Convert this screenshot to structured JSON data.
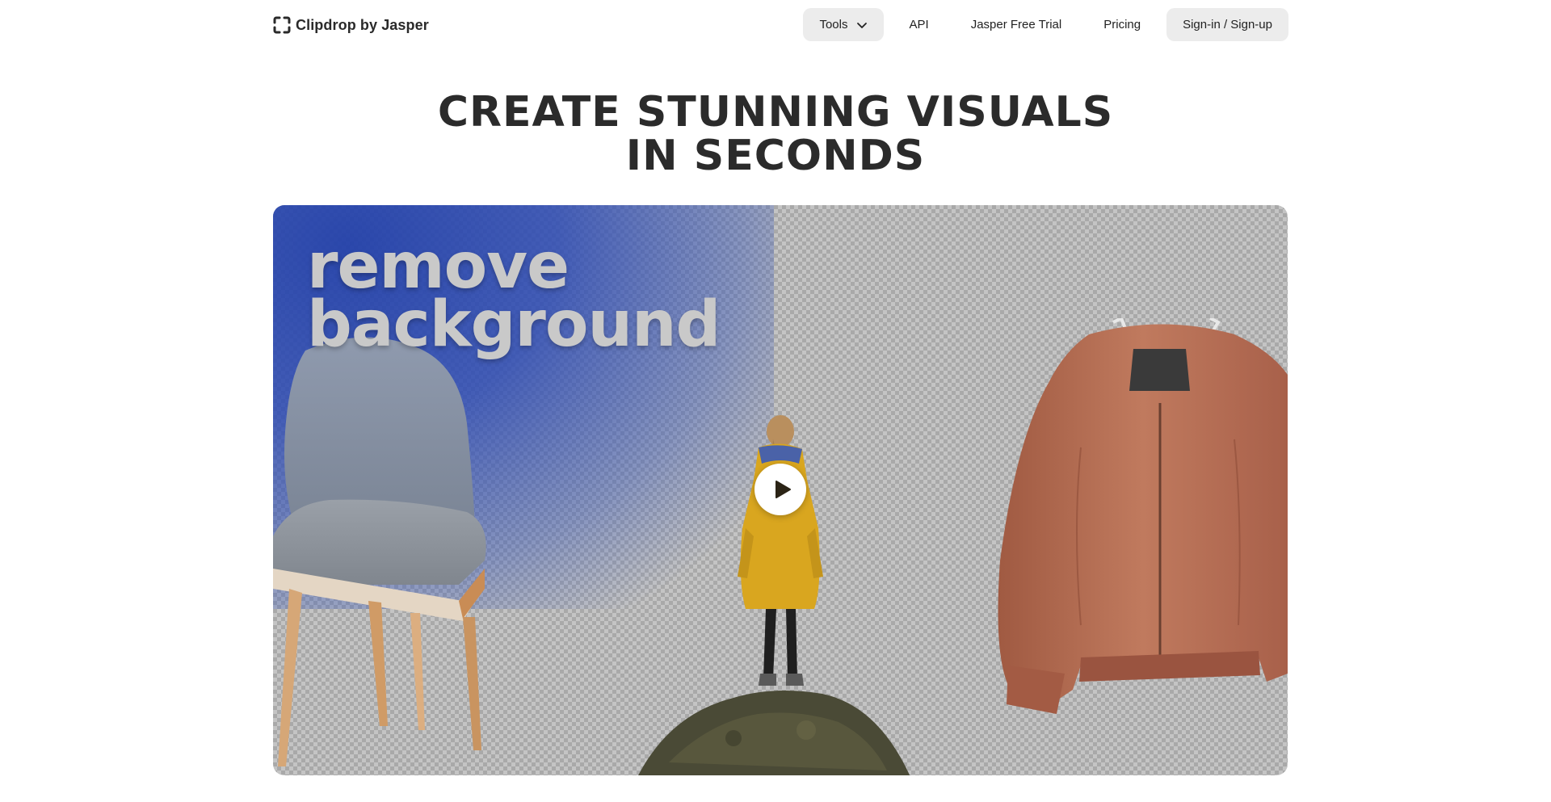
{
  "brand": {
    "name": "Clipdrop by Jasper",
    "logo_icon": "crop-frame-icon"
  },
  "nav": {
    "tools_label": "Tools",
    "api_label": "API",
    "trial_label": "Jasper Free Trial",
    "pricing_label": "Pricing",
    "signin_label": "Sign-in / Sign-up"
  },
  "hero": {
    "title_line1": "CREATE STUNNING VISUALS",
    "title_line2": "IN SECONDS"
  },
  "video": {
    "overlay_line1": "remove",
    "overlay_line2": "background",
    "play_icon": "play-icon"
  },
  "colors": {
    "pill_bg": "#ececec",
    "wash_blue": "#2341aa",
    "jacket": "#b56a50",
    "raincoat": "#d9a61f"
  }
}
